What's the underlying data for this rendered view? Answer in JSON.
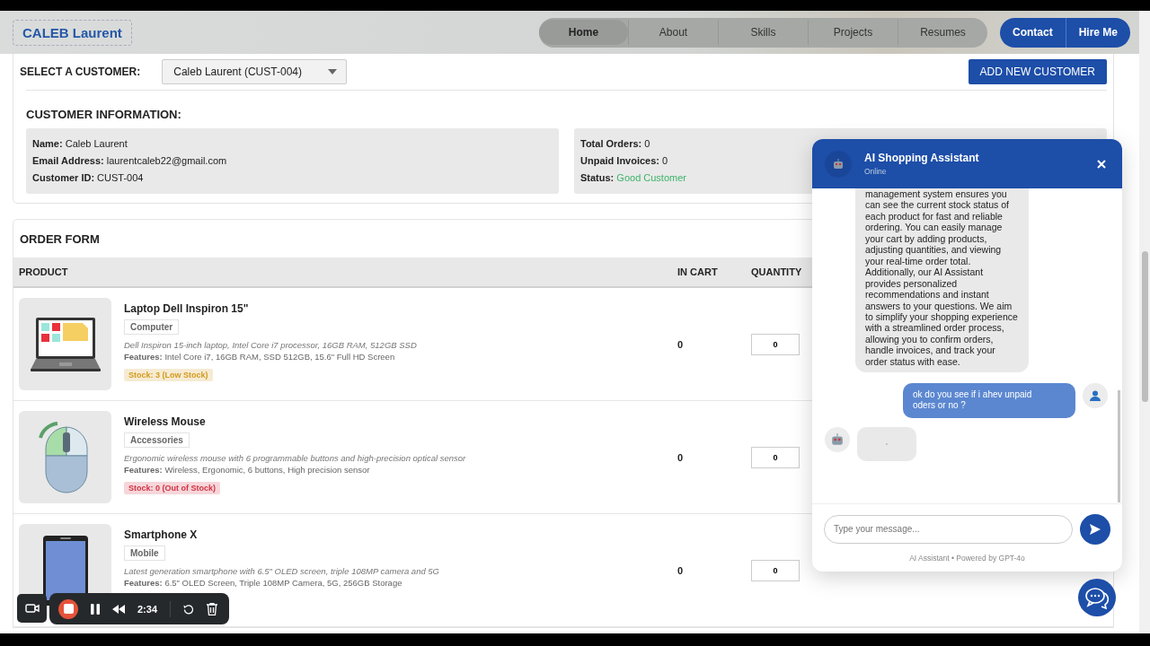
{
  "header": {
    "logo": "CALEB Laurent",
    "nav": [
      {
        "label": "Home",
        "selected": true
      },
      {
        "label": "About",
        "selected": false
      },
      {
        "label": "Skills",
        "selected": false
      },
      {
        "label": "Projects",
        "selected": false
      },
      {
        "label": "Resumes",
        "selected": false
      }
    ],
    "actions": [
      "Contact",
      "Hire Me"
    ]
  },
  "customer_select": {
    "label": "SELECT A CUSTOMER:",
    "value": "Caleb Laurent (CUST-004)",
    "add_button": "ADD NEW CUSTOMER"
  },
  "customer_info": {
    "title": "CUSTOMER INFORMATION:",
    "details": [
      {
        "label": "Name:",
        "value": "Caleb Laurent"
      },
      {
        "label": "Email Address:",
        "value": "laurentcaleb22@gmail.com"
      },
      {
        "label": "Customer ID:",
        "value": "CUST-004"
      }
    ],
    "stats": [
      {
        "label": "Total Orders:",
        "value": "0",
        "kind": "plain"
      },
      {
        "label": "Unpaid Invoices:",
        "value": "0",
        "kind": "plain"
      },
      {
        "label": "Status:",
        "value": "Good Customer",
        "kind": "status"
      }
    ]
  },
  "order_form": {
    "title": "ORDER FORM",
    "columns": [
      "PRODUCT",
      "IN CART",
      "QUANTITY"
    ],
    "products": [
      {
        "kind": "laptop",
        "name": "Laptop Dell Inspiron 15\"",
        "category": "Computer",
        "description": "Dell Inspiron 15-inch laptop, Intel Core i7 processor, 16GB RAM, 512GB SSD",
        "features_label": "Features:",
        "features": "Intel Core i7, 16GB RAM, SSD 512GB, 15.6\" Full HD Screen",
        "stock": "Stock: 3 (Low Stock)",
        "color": "#d39b1e",
        "in_cart": "0",
        "quantity": "0"
      },
      {
        "kind": "mouse",
        "name": "Wireless Mouse",
        "category": "Accessories",
        "description": "Ergonomic wireless mouse with 6 programmable buttons and high-precision optical sensor",
        "features_label": "Features:",
        "features": "Wireless, Ergonomic, 6 buttons, High precision sensor",
        "stock": "Stock: 0 (Out of Stock)",
        "color": "#d03344",
        "in_cart": "0",
        "quantity": "0"
      },
      {
        "kind": "phone",
        "name": "Smartphone X",
        "category": "Mobile",
        "description": "Latest generation smartphone with 6.5\" OLED screen, triple 108MP camera and 5G",
        "features_label": "Features:",
        "features": "6.5\" OLED Screen, Triple 108MP Camera, 5G, 256GB Storage",
        "in_cart": "0",
        "quantity": "0"
      }
    ]
  },
  "chat": {
    "title": "AI Shopping Assistant",
    "status": "Online",
    "messages": [
      {
        "kind": "bot",
        "text": "management system ensures you can see the current stock status of each product for fast and reliable ordering. You can easily manage your cart by adding products, adjusting quantities, and viewing your real-time order total. Additionally, our AI Assistant provides personalized recommendations and instant answers to your questions. We aim to simplify your shopping experience with a streamlined order process, allowing you to confirm orders, handle invoices, and track your order status with ease."
      },
      {
        "kind": "user",
        "text": "ok do you see if i ahev unpaid oders or no ?"
      },
      {
        "kind": "typing"
      }
    ],
    "placeholder": "Type your message...",
    "footer": "AI Assistant • Powered by GPT-4o"
  },
  "recorder": {
    "time": "2:34"
  }
}
